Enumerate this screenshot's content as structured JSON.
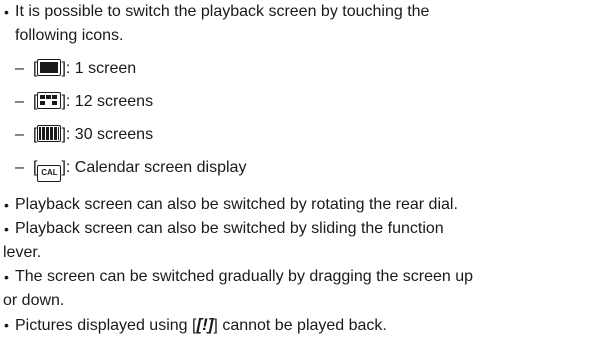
{
  "intro": {
    "line1": "It is possible to switch the playback screen by touching the",
    "line2": "following icons."
  },
  "icons": [
    {
      "name": "single-screen-icon",
      "label": "1 screen"
    },
    {
      "name": "twelve-screens-icon",
      "label": "12 screens"
    },
    {
      "name": "thirty-screens-icon",
      "label": "30 screens"
    },
    {
      "name": "calendar-icon",
      "label": "Calendar screen display",
      "icon_text": "CAL"
    }
  ],
  "bullets": {
    "rear_dial": "Playback screen can also be switched by rotating the rear dial.",
    "function_lever_l1": "Playback screen can also be switched by sliding the function",
    "function_lever_l2": "lever.",
    "drag_l1": "The screen can be switched gradually by dragging the screen up",
    "drag_l2": "or down.",
    "pictures_prefix": "Pictures displayed using [",
    "pictures_icon": "[!]",
    "pictures_suffix": "] cannot be played back."
  },
  "glyphs": {
    "bullet": "•",
    "dash": "–",
    "bracket_open": "[",
    "bracket_close_colon": "]:"
  }
}
